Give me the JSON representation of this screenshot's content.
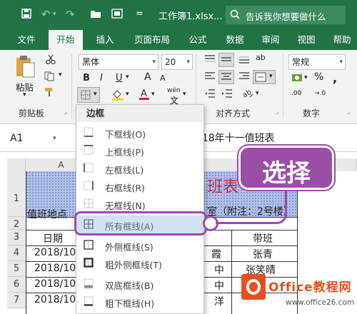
{
  "titlebar": {
    "save_icon": "save-icon",
    "undo_icon": "undo-icon",
    "redo_icon": "redo-icon",
    "open_icon": "folder-icon",
    "print_icon": "print-preview-icon",
    "qa_arrow": "=",
    "title": "工作簿1.xlsx...",
    "tellme": "告诉我你想要做什么"
  },
  "tabs": [
    "文件",
    "开始",
    "插入",
    "页面布局",
    "公式",
    "数据",
    "审阅",
    "视图",
    "帮助"
  ],
  "active_tab": "开始",
  "ribbon": {
    "paste": "粘贴",
    "clipboard_group": "剪贴板",
    "font_name": "黑体",
    "font_size": "20",
    "bold": "B",
    "italic": "I",
    "underline": "U",
    "grow_font": "A",
    "shrink_font": "A",
    "wen": "wén",
    "alignment_group": "对齐方式",
    "number_format": "常规",
    "percent": "%",
    "comma": ",",
    "inc_decimal": ".00",
    "dec_decimal": "→.0",
    "number_group": "数字",
    "wrap_icon": "ab"
  },
  "formula_bar": {
    "name_box": "A1",
    "formula_text": "2018年十一值班表"
  },
  "sheet": {
    "col_a": "A",
    "rows": [
      "1",
      "2",
      "3",
      "4",
      "5",
      "6",
      "7"
    ],
    "title_partial": "班表",
    "row2_left": "值班地点",
    "row2_right": "室（附注：2号楼）",
    "row3_left": "日期",
    "row3_right": "带班",
    "row4_left": "2018/10",
    "row4_mid": "霞",
    "row4_right": "张青",
    "row5_left": "2018/10",
    "row5_mid": "中",
    "row5_right": "张笑晴",
    "row6_left": "2018/10",
    "row6_mid": "中",
    "row7_left": "2018/10",
    "row7_mid": "洋"
  },
  "menu": {
    "header": "边框",
    "items": [
      {
        "label": "下框线(O)",
        "icon": "bottom-border-icon"
      },
      {
        "label": "上框线(P)",
        "icon": "top-border-icon"
      },
      {
        "label": "左框线(L)",
        "icon": "left-border-icon"
      },
      {
        "label": "右框线(R)",
        "icon": "right-border-icon"
      },
      {
        "label": "无框线(N)",
        "icon": "no-border-icon"
      },
      {
        "label": "所有框线(A)",
        "icon": "all-borders-icon"
      },
      {
        "label": "外侧框线(S)",
        "icon": "outside-borders-icon"
      },
      {
        "label": "粗外侧框线(T)",
        "icon": "thick-outside-borders-icon"
      },
      {
        "label": "双底框线(B)",
        "icon": "double-bottom-border-icon"
      },
      {
        "label": "粗下框线(H)",
        "icon": "thick-bottom-border-icon"
      }
    ],
    "highlighted_index": 5
  },
  "callout": {
    "text": "选择"
  },
  "watermark": {
    "title": "Office教程网",
    "url": "www.office26.com"
  },
  "colors": {
    "accent": "#217346",
    "callout": "#9b4ea6",
    "title_fill": "#b3c1e8",
    "watermark": "#e6501e"
  }
}
